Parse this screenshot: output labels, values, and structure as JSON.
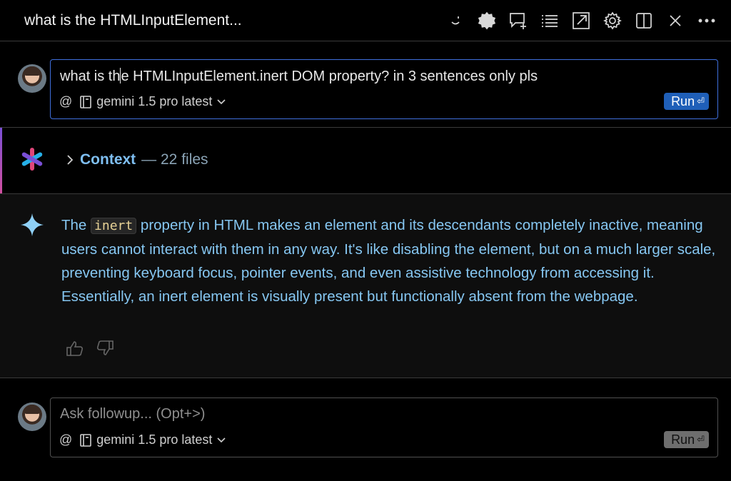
{
  "window": {
    "title": "what is the HTMLInputElement..."
  },
  "toolbar_icons": [
    "smile-icon",
    "badge-icon",
    "new-chat-icon",
    "history-list-icon",
    "open-external-icon",
    "settings-icon",
    "split-panel-icon",
    "close-icon",
    "more-icon"
  ],
  "query": {
    "text_before_caret": "what is th",
    "text_after_caret": "e HTMLInputElement.inert DOM property? in 3 sentences only pls",
    "mention_symbol": "@",
    "model": "gemini 1.5 pro latest",
    "run_label": "Run",
    "enter_glyph": "⏎"
  },
  "context": {
    "label": "Context",
    "count": "— 22 files"
  },
  "answer": {
    "before_code": "The ",
    "code": "inert",
    "after_code": " property in HTML makes an element and its descendants completely inactive, meaning users cannot interact with them in any way. It's like disabling the element, but on a much larger scale, preventing keyboard focus, pointer events, and even assistive technology from accessing it. Essentially, an inert element is visually present but functionally absent from the webpage."
  },
  "followup": {
    "placeholder": "Ask followup... (Opt+>)",
    "mention_symbol": "@",
    "model": "gemini 1.5 pro latest",
    "run_label": "Run",
    "enter_glyph": "⏎"
  },
  "colors": {
    "accent_blue": "#1f5fb8",
    "focus_border": "#3f6fdc",
    "answer_text": "#86c7f2",
    "context_label": "#7fbff2"
  }
}
